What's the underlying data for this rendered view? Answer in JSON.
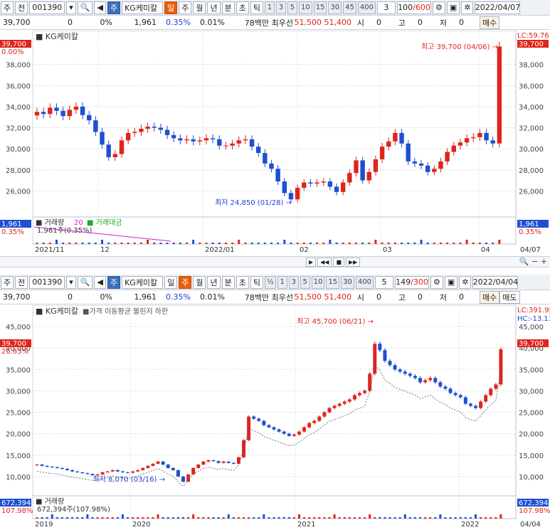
{
  "top": {
    "toolbar": {
      "market": "주",
      "type": "전",
      "code": "001390",
      "stock_btn": "주",
      "name": "KG케미칼",
      "periods": [
        "일",
        "주",
        "월",
        "년",
        "분",
        "초",
        "틱"
      ],
      "active_period": "일",
      "minutes": [
        "1",
        "3",
        "5",
        "10",
        "15",
        "30",
        "45",
        "400"
      ],
      "interval": "3",
      "count_current": "100",
      "count_total": "/600",
      "date": "2022/04/07"
    },
    "quote": {
      "price": "39,700",
      "change": "0",
      "rate": "0%",
      "volume": "1,961",
      "vol_rate": "0.35%",
      "turnover": "0.01%",
      "amount": "78백만",
      "best_label": "최우선",
      "ask": "51,500",
      "bid": "51,400",
      "open_label": "시",
      "open": "0",
      "high_label": "고",
      "high": "0",
      "low_label": "저",
      "low": "0",
      "buy_btn": "매수"
    },
    "legend": {
      "name": "KG케미칼",
      "volume_label": "거래량",
      "volume_ma": "20",
      "amount_label": "거래대금",
      "volume_info": "1,961주(0.35%)"
    },
    "annotations": {
      "high": "최고 39,700 (04/06)",
      "low": "최저 24,850 (01/28)"
    },
    "price_tag": "39,700",
    "rate_tag": "0.00%",
    "right_top_tag": "39,700",
    "right_top_lc": "LC:59.76",
    "vol_tag_left": "1,961",
    "vol_rate_left": "0.35%",
    "vol_tag_right": "1,961",
    "vol_rate_right": "0.35%",
    "x_labels": [
      "2021/11",
      "12",
      "2022/01",
      "02",
      "03",
      "04",
      "04/07"
    ]
  },
  "bottom": {
    "toolbar": {
      "market": "주",
      "type": "전",
      "code": "001390",
      "stock_btn": "주",
      "name": "KG케미칼",
      "periods": [
        "일",
        "주",
        "월",
        "년",
        "분",
        "초",
        "틱"
      ],
      "active_period": "주",
      "minutes": [
        "½",
        "1",
        "3",
        "5",
        "10",
        "15",
        "30",
        "400"
      ],
      "interval": "5",
      "count_current": "149",
      "count_total": "/300",
      "date": "2022/04/04"
    },
    "quote": {
      "price": "39,700",
      "change": "0",
      "rate": "0%",
      "volume": "1,961",
      "vol_rate": "0.35%",
      "turnover": "0.01%",
      "amount": "78백만",
      "best_label": "최우선",
      "ask": "51,500",
      "bid": "51,400",
      "open_label": "시",
      "open": "0",
      "high_label": "고",
      "high": "0",
      "low_label": "저",
      "low": "0",
      "buy_btn": "매수",
      "sell_btn": "매도"
    },
    "legend": {
      "name": "KG케미칼",
      "price_label": "가격 이동평균 볼린저 하한",
      "volume_label": "거래량",
      "volume_info": "672,394주(107.98%)"
    },
    "annotations": {
      "high": "최고 45,700 (06/21)",
      "low": "최저 8,070 (03/16)"
    },
    "price_tag": "39,700",
    "rate_tag": "26.63%",
    "right_lc": "LC:391.95",
    "right_hc": "HC:-13.13",
    "vol_tag_left": "672,394",
    "vol_rate_left": "107.98%",
    "vol_tag_right": "672,394",
    "vol_rate_right": "107.98%",
    "x_labels": [
      "2019",
      "2020",
      "2021",
      "2022",
      "04/04"
    ]
  },
  "chart_data": [
    {
      "type": "candlestick",
      "title": "KG케미칼",
      "period": "daily",
      "ylim": [
        24000,
        40000
      ],
      "yticks": [
        26000,
        28000,
        30000,
        32000,
        34000,
        36000,
        38000
      ],
      "values_close": [
        33500,
        33300,
        33900,
        33600,
        33100,
        33700,
        34000,
        33200,
        32700,
        31600,
        30400,
        29200,
        29500,
        30800,
        31500,
        31600,
        31900,
        32100,
        32000,
        31800,
        31300,
        31000,
        30800,
        30900,
        30700,
        30800,
        31000,
        30900,
        30300,
        30300,
        30500,
        30800,
        30900,
        30200,
        29600,
        28600,
        28100,
        26900,
        25800,
        25200,
        26300,
        26800,
        26700,
        26800,
        26900,
        26400,
        25900,
        26800,
        27700,
        28900,
        27000,
        27800,
        29000,
        30200,
        30700,
        31500,
        30500,
        28800,
        28600,
        28400,
        27800,
        28100,
        28800,
        29700,
        30300,
        30600,
        31000,
        31100,
        31500,
        30800,
        30500,
        39700
      ],
      "high": "39,700 (04/06)",
      "low": "24,850 (01/28)"
    },
    {
      "type": "candlestick",
      "title": "KG케미칼",
      "period": "weekly",
      "ylim": [
        6000,
        47000
      ],
      "yticks": [
        10000,
        15000,
        20000,
        25000,
        30000,
        35000,
        40000,
        45000
      ],
      "values_close": [
        12800,
        12500,
        12300,
        12200,
        12000,
        11800,
        11500,
        11200,
        11000,
        10800,
        10600,
        10300,
        10500,
        11000,
        11200,
        11500,
        11200,
        11000,
        10900,
        11200,
        11500,
        12000,
        12500,
        13000,
        13500,
        12800,
        12000,
        11500,
        10000,
        8800,
        10500,
        12000,
        12800,
        13500,
        13800,
        13600,
        13200,
        13500,
        13200,
        13000,
        14500,
        18500,
        24000,
        23500,
        23000,
        22000,
        21500,
        21000,
        20500,
        20000,
        19500,
        19800,
        20500,
        21500,
        22500,
        23000,
        24000,
        25000,
        26000,
        26500,
        27000,
        27500,
        28000,
        29000,
        29500,
        30000,
        34000,
        41000,
        39500,
        37000,
        36000,
        35000,
        34500,
        34000,
        33500,
        33000,
        32000,
        32500,
        33000,
        32000,
        31000,
        30500,
        29500,
        29000,
        28500,
        27000,
        26500,
        26000,
        27500,
        29000,
        30500,
        31500,
        39700
      ],
      "ma_line": true,
      "high": "45,700 (06/21)",
      "low": "8,070 (03/16)"
    }
  ],
  "colors": {
    "up": "#e0241b",
    "down": "#1d4fd1",
    "accent": "#e85d10",
    "volume_ma": "#d020d0",
    "amount": "#22aa22"
  }
}
